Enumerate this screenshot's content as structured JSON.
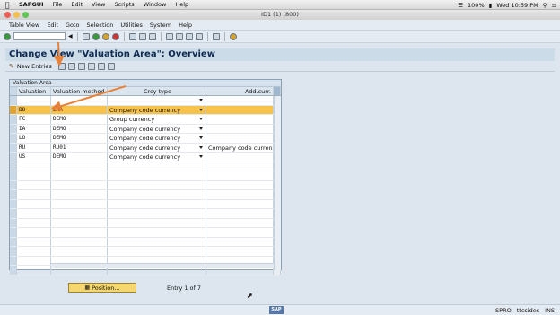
{
  "mac": {
    "app": "SAPGUI",
    "menus": [
      "File",
      "Edit",
      "View",
      "Scripts",
      "Window",
      "Help"
    ],
    "battery": "100%",
    "clock": "Wed 10:59 PM"
  },
  "window": {
    "title": "ID1 (1) (800)"
  },
  "sap_menu": [
    "Table View",
    "Edit",
    "Goto",
    "Selection",
    "Utilities",
    "System",
    "Help"
  ],
  "screen_title": "Change View \"Valuation Area\": Overview",
  "app_toolbar": {
    "new_entries": "New Entries"
  },
  "grid": {
    "caption": "Valuation Area",
    "headers": [
      "Valuation",
      "Valuation method",
      "Crcy type",
      "Add.curr."
    ],
    "rows": [
      {
        "a": "",
        "b": "",
        "c": "",
        "d": ""
      },
      {
        "a": "B8",
        "b": "EMA",
        "c": "Company code currency",
        "d": ""
      },
      {
        "a": "FC",
        "b": "DEMO",
        "c": "Group currency",
        "d": ""
      },
      {
        "a": "IA",
        "b": "DEMO",
        "c": "Company code currency",
        "d": ""
      },
      {
        "a": "LO",
        "b": "DEMO",
        "c": "Company code currency",
        "d": ""
      },
      {
        "a": "RU",
        "b": "RU01",
        "c": "Company code currency",
        "d": "Company code currency"
      },
      {
        "a": "US",
        "b": "DEMO",
        "c": "Company code currency",
        "d": ""
      }
    ]
  },
  "position_button": "Position...",
  "entry_info": "Entry 1 of 7",
  "status": {
    "sap": "SAP",
    "tcode": "SPRO",
    "server": "ttcsides",
    "mode": "INS"
  },
  "colors": {
    "selected_row": "#f7c24a",
    "annotation_arrow": "#e8823a"
  }
}
